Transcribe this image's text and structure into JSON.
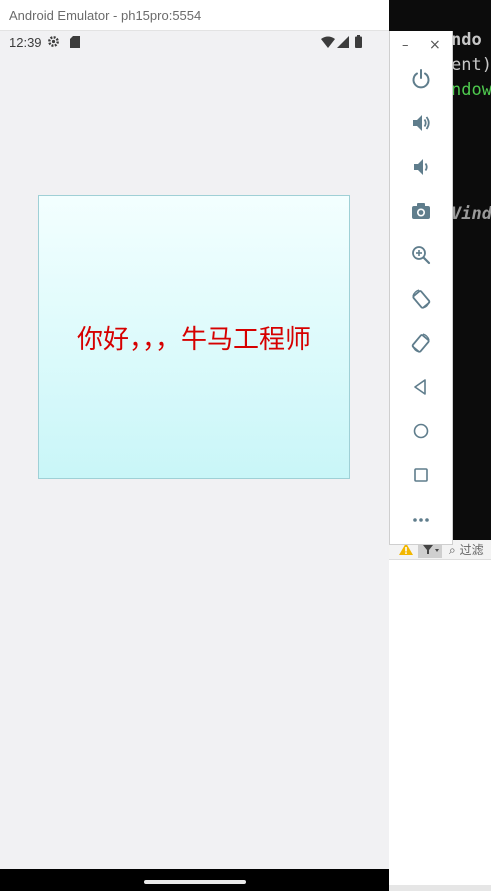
{
  "emulator": {
    "window_title": "Android Emulator - ph15pro:5554"
  },
  "status_bar": {
    "time": "12:39"
  },
  "app": {
    "greeting_text": "你好，，，牛马工程师"
  },
  "toolbar": {
    "minimize_label": "–",
    "close_label": "×",
    "buttons": [
      {
        "name": "power",
        "icon": "power-icon"
      },
      {
        "name": "volume-up",
        "icon": "volume-up-icon"
      },
      {
        "name": "volume-down",
        "icon": "volume-down-icon"
      },
      {
        "name": "screenshot",
        "icon": "camera-icon"
      },
      {
        "name": "zoom",
        "icon": "zoom-icon"
      },
      {
        "name": "rotate-left",
        "icon": "rotate-left-icon"
      },
      {
        "name": "rotate-right",
        "icon": "rotate-right-icon"
      },
      {
        "name": "back",
        "icon": "back-icon"
      },
      {
        "name": "home",
        "icon": "home-icon"
      },
      {
        "name": "overview",
        "icon": "overview-icon"
      },
      {
        "name": "more",
        "icon": "more-icon"
      }
    ]
  },
  "background": {
    "terminal_lines": [
      "ndo",
      "ent)",
      "ndow",
      "Vind"
    ],
    "panel_filter_text": "过滤"
  },
  "colors": {
    "greeting": "#d60000",
    "card_top": "#f3ffff",
    "card_bottom": "#c9f6f8",
    "screen_bg": "#f1f1f3",
    "toolbar_icon": "#5f7d8c",
    "terminal_green": "#4ec94e"
  }
}
